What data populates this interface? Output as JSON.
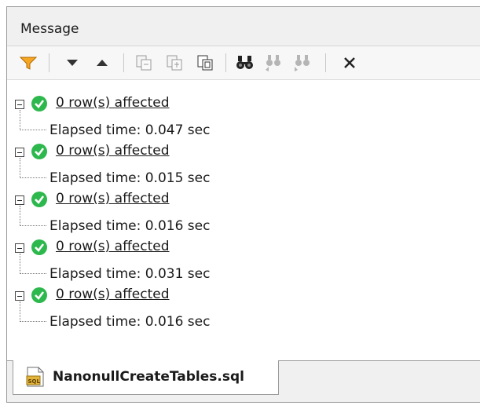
{
  "panel": {
    "title": "Message"
  },
  "toolbar": {
    "buttons": [
      {
        "name": "filter",
        "icon": "filter-icon"
      },
      {
        "name": "next",
        "icon": "arrow-down-icon"
      },
      {
        "name": "previous",
        "icon": "arrow-up-icon"
      },
      {
        "name": "copy-selected",
        "icon": "copy-selected-icon"
      },
      {
        "name": "copy-child",
        "icon": "copy-child-icon"
      },
      {
        "name": "copy-all",
        "icon": "copy-all-icon"
      },
      {
        "name": "find",
        "icon": "binoculars-icon"
      },
      {
        "name": "find-previous",
        "icon": "binoculars-prev-icon"
      },
      {
        "name": "find-next",
        "icon": "binoculars-next-icon"
      },
      {
        "name": "clear",
        "icon": "close-icon"
      }
    ]
  },
  "messages": [
    {
      "affected": "0 row(s) affected",
      "elapsed": "Elapsed time: 0.047 sec"
    },
    {
      "affected": "0 row(s) affected",
      "elapsed": "Elapsed time: 0.015 sec"
    },
    {
      "affected": "0 row(s) affected",
      "elapsed": "Elapsed time: 0.016 sec"
    },
    {
      "affected": "0 row(s) affected",
      "elapsed": "Elapsed time: 0.031 sec"
    },
    {
      "affected": "0 row(s) affected",
      "elapsed": "Elapsed time: 0.016 sec"
    }
  ],
  "tab": {
    "label": "NanonullCreateTables.sql",
    "icon": "sql-file-icon"
  },
  "colors": {
    "success": "#2db84d",
    "filter": "#f5a623"
  }
}
